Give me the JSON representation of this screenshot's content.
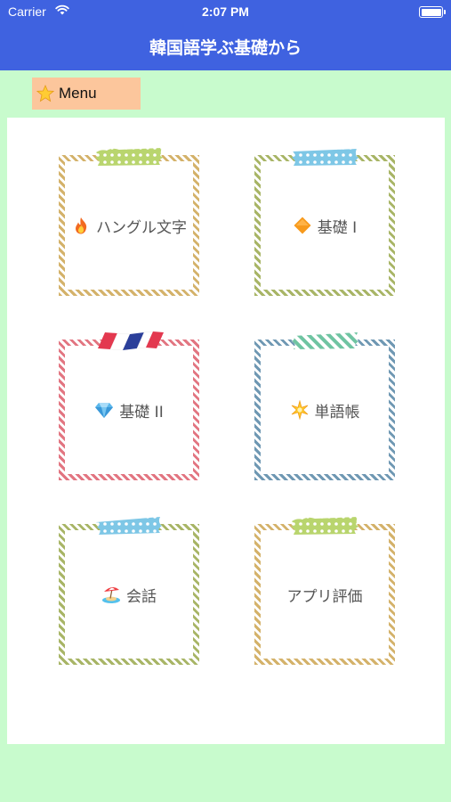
{
  "status_bar": {
    "carrier": "Carrier",
    "time": "2:07 PM",
    "icons": [
      "wifi-icon",
      "battery-icon"
    ]
  },
  "nav": {
    "title": "韓国語学ぶ基礎から"
  },
  "menu_button": {
    "label": "Menu",
    "icon": "star-icon"
  },
  "colors": {
    "bar": "#3f62e0",
    "background": "#c8fbcd",
    "panel": "#ffffff",
    "menu_button": "#fcc69c",
    "frame_tan": "#d4b26a",
    "frame_olive": "#a8b566",
    "frame_pink": "#e27581",
    "frame_blue": "#6f98b3"
  },
  "cards": [
    {
      "label": "ハングル文字",
      "icon": "fire-icon",
      "frame": "tan",
      "tape": "green-polka-dot-tape"
    },
    {
      "label": "基礎 I",
      "icon": "orange-diamond-icon",
      "frame": "olive",
      "tape": "blue-polka-dot-tape"
    },
    {
      "label": "基礎 II",
      "icon": "gem-icon",
      "frame": "pink",
      "tape": "tricolor-tape"
    },
    {
      "label": "単語帳",
      "icon": "sparkle-icon",
      "frame": "blue",
      "tape": "green-striped-tape"
    },
    {
      "label": "会話",
      "icon": "beach-icon",
      "frame": "olive",
      "tape": "blue-polka-dot-tape"
    },
    {
      "label": "アプリ評価",
      "icon": "",
      "frame": "tan",
      "tape": "green-polka-dot-tape"
    }
  ]
}
